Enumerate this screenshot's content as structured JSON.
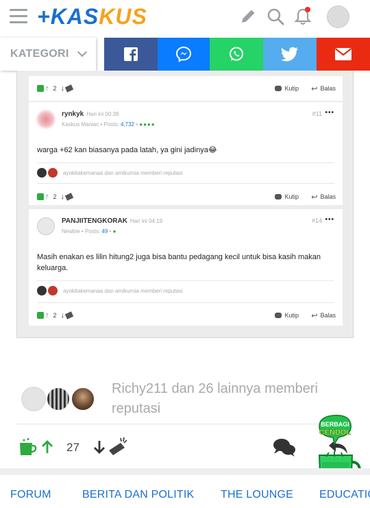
{
  "header": {
    "logo_main": "KASKUS",
    "logo_plus": "+",
    "icons": [
      "menu-icon",
      "pencil-icon",
      "search-icon",
      "bell-icon",
      "avatar"
    ]
  },
  "sharebar": {
    "kategori_label": "KATEGORI",
    "buttons": [
      "facebook-icon",
      "messenger-icon",
      "whatsapp-icon",
      "twitter-icon",
      "email-icon"
    ],
    "colors": {
      "facebook": "#3b5998",
      "messenger": "#0a7cff",
      "whatsapp": "#25d366",
      "twitter": "#55acee",
      "email": "#ea2b12"
    }
  },
  "quoted": {
    "top_vote": {
      "count": "2",
      "kutip": "Kutip",
      "balas": "Balas"
    },
    "posts": [
      {
        "user": "rynkyk",
        "time": "Hari ini 00:38",
        "rank": "Kaskus Maniac",
        "posts_label": "Posts:",
        "posts_count": "4,732",
        "dots": "●●●●",
        "number": "#11",
        "text": "warga +62 kan biasanya pada latah, ya gini jadinya😂",
        "reputation": "ayokitakemanaa dan amikurnia memberi reputasi",
        "vote_count": "2",
        "kutip": "Kutip",
        "balas": "Balas"
      },
      {
        "user": "PANJIITENGKORAK",
        "time": "Hari ini 04:19",
        "rank": "Newbie",
        "posts_label": "Posts:",
        "posts_count": "49",
        "dots": "●",
        "number": "#14",
        "text": "Masih enakan es lilin hitung2 juga bisa bantu pedagang kecil untuk bisa kasih makan keluarga.",
        "reputation": "ayokitakemanaa dan amikurnia memberi reputasi",
        "vote_count": "2",
        "kutip": "Kutip",
        "balas": "Balas"
      }
    ]
  },
  "reputation": {
    "text": "Richy211 dan 26 lainnya memberi reputasi"
  },
  "actions": {
    "vote_count": "27"
  },
  "badge": {
    "line1": "BERBAGI",
    "line2": "CENDOL"
  },
  "bottom_nav": {
    "items": [
      "FORUM",
      "BERITA DAN POLITIK",
      "THE LOUNGE",
      "EDUCATION"
    ]
  }
}
